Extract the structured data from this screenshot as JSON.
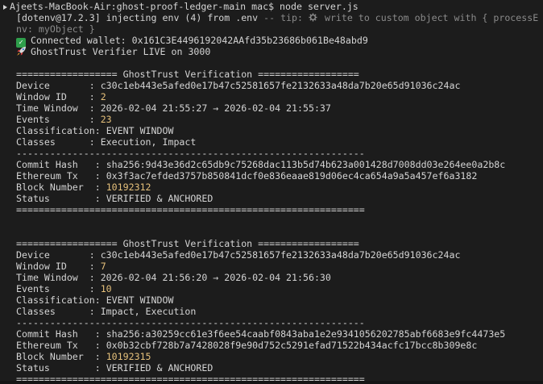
{
  "terminal": {
    "prompt": "Ajeets-MacBook-Air:ghost-proof-ledger-main mac$",
    "command": "node server.js",
    "dotenv_prefix": "[dotenv@17.2.3] injecting env (4) from .env",
    "dotenv_tip_prefix": " -- tip: ",
    "dotenv_tip_text": " write to custom object with { processE",
    "dotenv_tip_cont": "nv: myObject }",
    "connected_wallet": "Connected wallet: 0x161C3E4496192042AAfd35b23686b061Be48abd9",
    "verifier_live": "GhostTrust Verifier LIVE on 3000"
  },
  "blocks": [
    {
      "header": "================== GhostTrust Verification ==================",
      "device_label": "Device       : ",
      "device": "c30c1eb443e5afed0e17b47c52581657fe2132633a48da7b20e65d91036c24ac",
      "window_label": "Window ID    : ",
      "window_id": "2",
      "time_label": "Time Window  : ",
      "time_window": "2026-02-04 21:55:27 → 2026-02-04 21:55:37",
      "events_label": "Events       : ",
      "events": "23",
      "classification_label": "Classification: ",
      "classification": "EVENT WINDOW",
      "classes_label": "Classes      : ",
      "classes": "Execution, Impact",
      "divider": "--------------------------------------------------------------",
      "commit_label": "Commit Hash   : ",
      "commit_hash": "sha256:9d43e36d2c65db9c75268dac113b5d74b623a001428d7008dd03e264ee0a2b8c",
      "eth_label": "Ethereum Tx   : ",
      "eth_tx": "0x3f3ac7efded3757b850841dcf0e836eaae819d06ec4ca654a9a5a457ef6a3182",
      "block_label": "Block Number  : ",
      "block_number": "10192312",
      "status_label": "Status        : ",
      "status": "VERIFIED & ANCHORED",
      "footer": "=============================================================="
    },
    {
      "header": "================== GhostTrust Verification ==================",
      "device_label": "Device       : ",
      "device": "c30c1eb443e5afed0e17b47c52581657fe2132633a48da7b20e65d91036c24ac",
      "window_label": "Window ID    : ",
      "window_id": "7",
      "time_label": "Time Window  : ",
      "time_window": "2026-02-04 21:56:20 → 2026-02-04 21:56:30",
      "events_label": "Events       : ",
      "events": "10",
      "classification_label": "Classification: ",
      "classification": "EVENT WINDOW",
      "classes_label": "Classes      : ",
      "classes": "Impact, Execution",
      "divider": "--------------------------------------------------------------",
      "commit_label": "Commit Hash   : ",
      "commit_hash": "sha256:a30259cc61e3f6ee54caabf0843aba1e2e9341056202785abf6683e9fc4473e5",
      "eth_label": "Ethereum Tx   : ",
      "eth_tx": "0x0b32cbf728b7a7428028f9e90d752c5291efad71522b434acfc17bcc8b309e8c",
      "block_label": "Block Number  : ",
      "block_number": "10192315",
      "status_label": "Status        : ",
      "status": "VERIFIED & ANCHORED",
      "footer": "=============================================================="
    }
  ]
}
